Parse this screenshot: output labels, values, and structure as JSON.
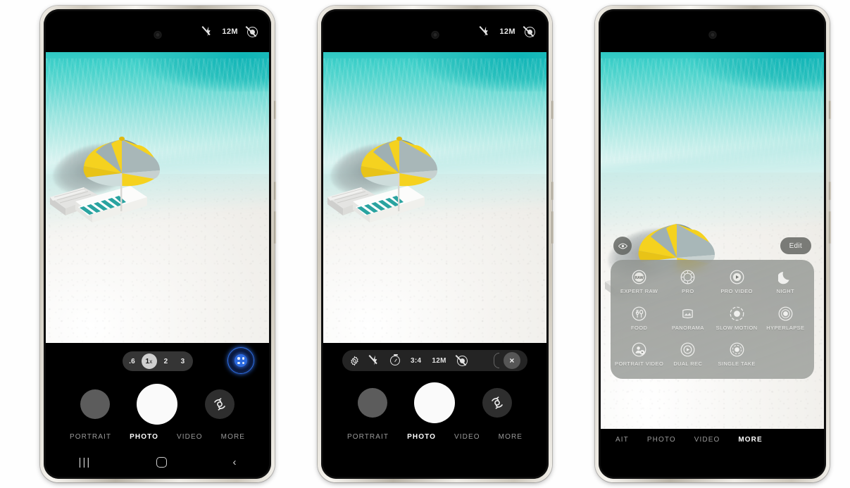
{
  "page": {
    "title": "Samsung Galaxy Camera App — Photo mode, settings toolbar and MORE modes panel"
  },
  "colors": {
    "accent_blue": "#2c6ae0",
    "sea_teal": "#2fc7c2",
    "frame_titanium": "#cfc9bd",
    "umbrella_yellow": "#f5d21f",
    "umbrella_gray": "#9fb0b2",
    "panel_gray": "#969995",
    "active_white": "#ffffff",
    "inactive_gray": "#9a9a9a"
  },
  "phone1": {
    "status": {
      "flash_icon": "flash-off-icon",
      "resolution": "12M",
      "motion_icon": "motion-photo-off-icon"
    },
    "zoom": {
      "options": [
        {
          "label": ".6",
          "active": false
        },
        {
          "label": "1",
          "suffix": "x",
          "active": true
        },
        {
          "label": "2",
          "active": false
        },
        {
          "label": "3",
          "active": false
        }
      ]
    },
    "ai_button": "ai-zoom-grid-icon",
    "controls": {
      "gallery": "gallery-thumbnail-button",
      "shutter": "shutter-button",
      "flip": "flip-camera-button"
    },
    "modes": [
      {
        "label": "PORTRAIT",
        "active": false
      },
      {
        "label": "PHOTO",
        "active": true
      },
      {
        "label": "VIDEO",
        "active": false
      },
      {
        "label": "MORE",
        "active": false
      }
    ],
    "navbar": {
      "recents": "|||",
      "home": "home-icon",
      "back": "‹"
    }
  },
  "phone2": {
    "status": {
      "flash_icon": "flash-off-icon",
      "resolution": "12M",
      "motion_icon": "motion-photo-off-icon"
    },
    "toolbar": [
      {
        "name": "settings",
        "icon": "gear-icon",
        "label": ""
      },
      {
        "name": "flash",
        "icon": "flash-off-icon",
        "label": ""
      },
      {
        "name": "timer",
        "icon": "timer-icon",
        "label": ""
      },
      {
        "name": "aspect-ratio",
        "icon": "",
        "label": "3:4"
      },
      {
        "name": "resolution",
        "icon": "",
        "label": "12M"
      },
      {
        "name": "motion-photo",
        "icon": "motion-photo-off-icon",
        "label": ""
      }
    ],
    "toolbar_close": "×",
    "controls": {
      "gallery": "gallery-thumbnail-button",
      "shutter": "shutter-button",
      "flip": "flip-camera-button"
    },
    "modes": [
      {
        "label": "PORTRAIT",
        "active": false
      },
      {
        "label": "PHOTO",
        "active": true
      },
      {
        "label": "VIDEO",
        "active": false
      },
      {
        "label": "MORE",
        "active": false
      }
    ]
  },
  "phone3": {
    "eye_button": "preview-eye-icon",
    "edit_button": "Edit",
    "more_modes": [
      {
        "label": "EXPERT RAW",
        "icon": "raw-icon"
      },
      {
        "label": "PRO",
        "icon": "pro-dial-icon"
      },
      {
        "label": "PRO VIDEO",
        "icon": "pro-video-icon"
      },
      {
        "label": "NIGHT",
        "icon": "moon-icon"
      },
      {
        "label": "FOOD",
        "icon": "food-fork-spoon-icon"
      },
      {
        "label": "PANORAMA",
        "icon": "panorama-icon"
      },
      {
        "label": "SLOW MOTION",
        "icon": "slow-motion-icon"
      },
      {
        "label": "HYPERLAPSE",
        "icon": "hyperlapse-icon"
      },
      {
        "label": "PORTRAIT VIDEO",
        "icon": "portrait-video-icon"
      },
      {
        "label": "DUAL REC",
        "icon": "dual-rec-icon"
      },
      {
        "label": "SINGLE TAKE",
        "icon": "single-take-icon"
      }
    ],
    "modes": [
      {
        "label": "AIT",
        "active": false
      },
      {
        "label": "PHOTO",
        "active": false
      },
      {
        "label": "VIDEO",
        "active": false
      },
      {
        "label": "MORE",
        "active": true
      }
    ]
  }
}
